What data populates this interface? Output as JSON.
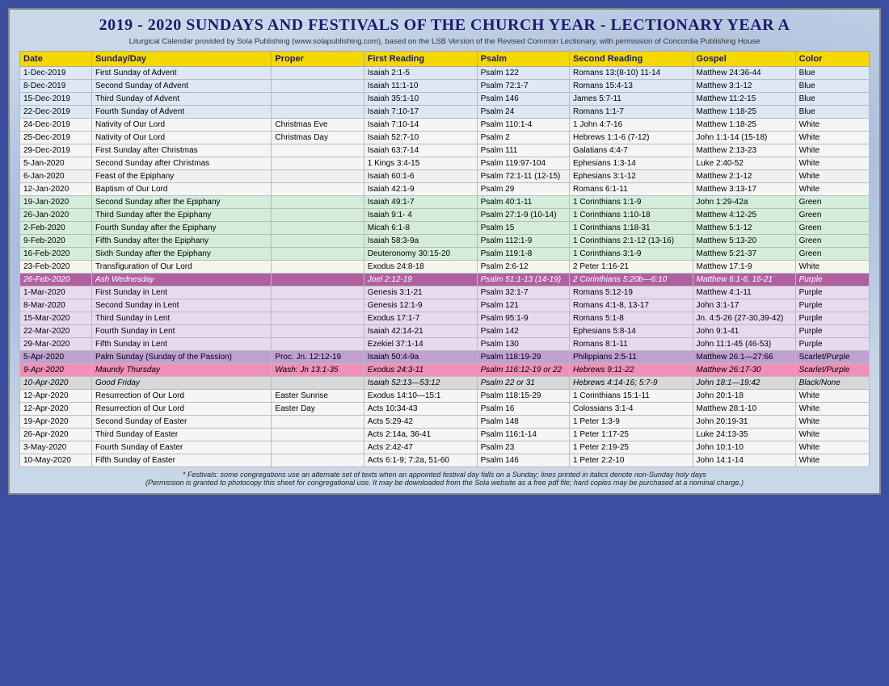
{
  "title": "2019 - 2020 Sundays and Festivals of the Church Year - Lectionary Year A",
  "subtitle": "Liturgical Calendar provided by Sola Publishing (www.solapublishing.com), based on the LSB Version of the Revised Common Lectionary, with permission of Concordia Publishing House",
  "headers": [
    "Date",
    "Sunday/Day",
    "Proper",
    "First Reading",
    "Psalm",
    "Second Reading",
    "Gospel",
    "Color"
  ],
  "rows": [
    [
      "1-Dec-2019",
      "First Sunday of Advent",
      "",
      "Isaiah 2:1-5",
      "Psalm 122",
      "Romans 13:(8-10) 11-14",
      "Matthew 24:36-44",
      "Blue",
      "blue"
    ],
    [
      "8-Dec-2019",
      "Second Sunday of Advent",
      "",
      "Isaiah 11:1-10",
      "Psalm 72:1-7",
      "Romans 15:4-13",
      "Matthew 3:1-12",
      "Blue",
      "blue"
    ],
    [
      "15-Dec-2019",
      "Third Sunday of Advent",
      "",
      "Isaiah 35:1-10",
      "Psalm 146",
      "James 5:7-11",
      "Matthew 11:2-15",
      "Blue",
      "blue"
    ],
    [
      "22-Dec-2019",
      "Fourth Sunday of Advent",
      "",
      "Isaiah 7:10-17",
      "Psalm 24",
      "Romans 1:1-7",
      "Matthew 1:18-25",
      "Blue",
      "blue"
    ],
    [
      "24-Dec-2019",
      "Nativity of Our Lord",
      "Christmas Eve",
      "Isaiah 7:10-14",
      "Psalm 110:1-4",
      "1 John 4:7-16",
      "Matthew 1:18-25",
      "White",
      "white"
    ],
    [
      "25-Dec-2019",
      "Nativity of Our Lord",
      "Christmas Day",
      "Isaiah 52:7-10",
      "Psalm 2",
      "Hebrews 1:1-6 (7-12)",
      "John 1:1-14 (15-18)",
      "White",
      "white"
    ],
    [
      "29-Dec-2019",
      "First Sunday after Christmas",
      "",
      "Isaiah 63:7-14",
      "Psalm 111",
      "Galatians 4:4-7",
      "Matthew 2:13-23",
      "White",
      "white"
    ],
    [
      "5-Jan-2020",
      "Second Sunday after Christmas",
      "",
      "1 Kings 3:4-15",
      "Psalm 119:97-104",
      "Ephesians 1:3-14",
      "Luke 2:40-52",
      "White",
      "white"
    ],
    [
      "6-Jan-2020",
      "Feast of the Epiphany",
      "",
      "Isaiah 60:1-6",
      "Psalm 72:1-11 (12-15)",
      "Ephesians 3:1-12",
      "Matthew 2:1-12",
      "White",
      "white-feast"
    ],
    [
      "12-Jan-2020",
      "Baptism of Our Lord",
      "",
      "Isaiah 42:1-9",
      "Psalm 29",
      "Romans 6:1-11",
      "Matthew 3:13-17",
      "White",
      "white"
    ],
    [
      "19-Jan-2020",
      "Second Sunday after the Epiphany",
      "",
      "Isaiah 49:1-7",
      "Psalm 40:1-11",
      "1 Corinthians 1:1-9",
      "John 1:29-42a",
      "Green",
      "green"
    ],
    [
      "26-Jan-2020",
      "Third Sunday after the Epiphany",
      "",
      "Isaiah 9:1- 4",
      "Psalm 27:1-9 (10-14)",
      "1 Corinthians 1:10-18",
      "Matthew 4:12-25",
      "Green",
      "green"
    ],
    [
      "2-Feb-2020",
      "Fourth Sunday after the Epiphany",
      "",
      "Micah 6:1-8",
      "Psalm 15",
      "1 Corinthians 1:18-31",
      "Matthew 5:1-12",
      "Green",
      "green"
    ],
    [
      "9-Feb-2020",
      "Fifth Sunday after the Epiphany",
      "",
      "Isaiah 58:3-9a",
      "Psalm 112:1-9",
      "1 Corinthians 2:1-12 (13-16)",
      "Matthew 5:13-20",
      "Green",
      "green"
    ],
    [
      "16-Feb-2020",
      "Sixth Sunday after the Epiphany",
      "",
      "Deuteronomy 30:15-20",
      "Psalm 119:1-8",
      "1 Corinthians 3:1-9",
      "Matthew 5:21-37",
      "Green",
      "green"
    ],
    [
      "23-Feb-2020",
      "Transfiguration of Our Lord",
      "",
      "Exodus 24:8-18",
      "Psalm 2:6-12",
      "2 Peter 1:16-21",
      "Matthew 17:1-9",
      "White",
      "transfig"
    ],
    [
      "26-Feb-2020",
      "Ash Wednesday",
      "",
      "Joel 2:12-19",
      "Psalm 51:1-13 (14-19)",
      "2 Corinthians 5:20b—6:10",
      "Matthew 6:1-6, 16-21",
      "Purple",
      "ash"
    ],
    [
      "1-Mar-2020",
      "First Sunday in Lent",
      "",
      "Genesis 3:1-21",
      "Psalm 32:1-7",
      "Romans 5:12-19",
      "Matthew 4:1-11",
      "Purple",
      "purple"
    ],
    [
      "8-Mar-2020",
      "Second Sunday in Lent",
      "",
      "Genesis 12:1-9",
      "Psalm 121",
      "Romans 4:1-8, 13-17",
      "John 3:1-17",
      "Purple",
      "purple"
    ],
    [
      "15-Mar-2020",
      "Third Sunday in Lent",
      "",
      "Exodus 17:1-7",
      "Psalm 95:1-9",
      "Romans 5:1-8",
      "Jn. 4:5-26 (27-30,39-42)",
      "Purple",
      "purple"
    ],
    [
      "22-Mar-2020",
      "Fourth Sunday in Lent",
      "",
      "Isaiah 42:14-21",
      "Psalm 142",
      "Ephesians 5:8-14",
      "John 9:1-41",
      "Purple",
      "purple"
    ],
    [
      "29-Mar-2020",
      "Fifth Sunday in Lent",
      "",
      "Ezekiel 37:1-14",
      "Psalm 130",
      "Romans 8:1-11",
      "John 11:1-45 (46-53)",
      "Purple",
      "purple"
    ],
    [
      "5-Apr-2020",
      "Palm Sunday (Sunday of the Passion)",
      "Proc. Jn. 12:12-19",
      "Isaiah 50:4-9a",
      "Psalm 118:19-29",
      "Philippians 2:5-11",
      "Matthew 26:1—27:66",
      "Scarlet/Purple",
      "palm"
    ],
    [
      "9-Apr-2020",
      "Maundy Thursday",
      "Wash: Jn 13:1-35",
      "Exodus 24:3-11",
      "Psalm 116:12-19 or 22",
      "Hebrews 9:11-22",
      "Matthew 26:17-30",
      "Scarlet/Purple",
      "maundy"
    ],
    [
      "10-Apr-2020",
      "Good Friday",
      "",
      "Isaiah 52:13—53:12",
      "Psalm 22 or 31",
      "Hebrews 4:14-16; 5:7-9",
      "John 18:1—19:42",
      "Black/None",
      "good"
    ],
    [
      "12-Apr-2020",
      "Resurrection of Our Lord",
      "Easter Sunrise",
      "Exodus 14:10—15:1",
      "Psalm 118:15-29",
      "1 Corinthians 15:1-11",
      "John 20:1-18",
      "White",
      "white"
    ],
    [
      "12-Apr-2020",
      "Resurrection of Our Lord",
      "Easter Day",
      "Acts 10:34-43",
      "Psalm 16",
      "Colossians 3:1-4",
      "Matthew 28:1-10",
      "White",
      "white"
    ],
    [
      "19-Apr-2020",
      "Second Sunday of Easter",
      "",
      "Acts 5:29-42",
      "Psalm 148",
      "1 Peter 1:3-9",
      "John 20:19-31",
      "White",
      "white"
    ],
    [
      "26-Apr-2020",
      "Third Sunday of Easter",
      "",
      "Acts 2:14a, 36-41",
      "Psalm 116:1-14",
      "1 Peter 1:17-25",
      "Luke 24:13-35",
      "White",
      "white"
    ],
    [
      "3-May-2020",
      "Fourth Sunday of Easter",
      "",
      "Acts 2:42-47",
      "Psalm 23",
      "1 Peter 2:19-25",
      "John 10:1-10",
      "White",
      "white"
    ],
    [
      "10-May-2020",
      "Fifth Sunday of Easter",
      "",
      "Acts 6:1-9; 7:2a, 51-60",
      "Psalm 146",
      "1 Peter 2:2-10",
      "John 14:1-14",
      "White",
      "white"
    ]
  ],
  "footer": [
    "* Festivals: some congregations use an alternate set of texts when an appointed festival day falls on a Sunday; lines printed in italics denote non-Sunday holy days",
    "(Permission is granted to photocopy this sheet for congregational use. It may be downloaded from the Sola website as a free pdf file; hard copies may be purchased at a nominal charge.)"
  ]
}
